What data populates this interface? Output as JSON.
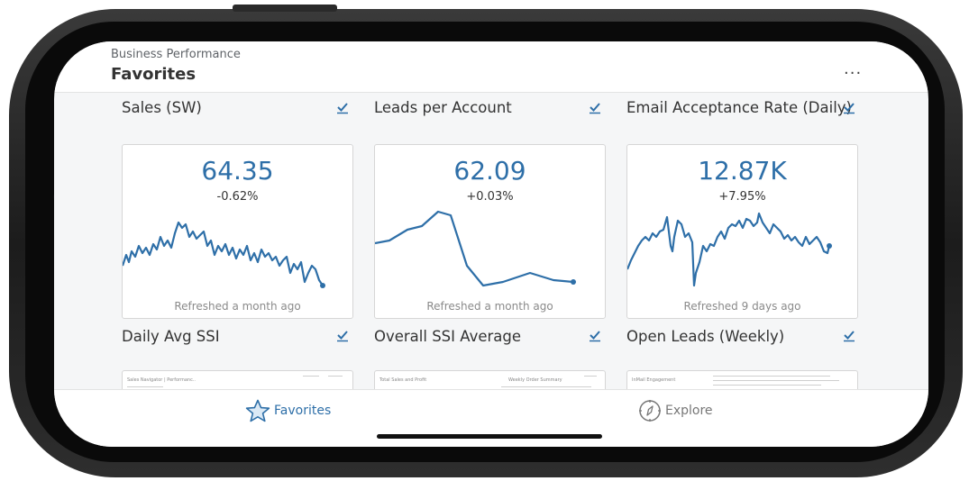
{
  "header": {
    "breadcrumb": "Business Performance",
    "title": "Favorites",
    "more_label": "..."
  },
  "cards": [
    {
      "title": "Sales (SW)",
      "value": "64.35",
      "change": "-0.62%",
      "refreshed": "Refreshed a month ago",
      "favorite_icon": "favorite-check-icon"
    },
    {
      "title": "Leads per Account",
      "value": "62.09",
      "change": "+0.03%",
      "refreshed": "Refreshed a month ago",
      "favorite_icon": "favorite-check-icon"
    },
    {
      "title": "Email Acceptance Rate (Daily)",
      "value": "12.87K",
      "change": "+7.95%",
      "refreshed": "Refreshed 9 days ago",
      "favorite_icon": "favorite-check-icon"
    },
    {
      "title": "Daily Avg SSI",
      "preview_text": "Sales Navigator | Performanc..",
      "favorite_icon": "favorite-check-icon"
    },
    {
      "title": "Overall SSI Average",
      "preview_text": "Total Sales and Profit",
      "preview_text_2": "Weekly Order Summary",
      "favorite_icon": "favorite-check-icon"
    },
    {
      "title": "Open Leads (Weekly)",
      "preview_text": "InMail Engagement",
      "favorite_icon": "favorite-check-icon"
    }
  ],
  "tabs": [
    {
      "label": "Favorites",
      "icon": "star-icon",
      "active": true
    },
    {
      "label": "Explore",
      "icon": "compass-icon",
      "active": false
    }
  ],
  "colors": {
    "accent": "#2e6fa8",
    "text": "#333333",
    "muted": "#8a8a8a",
    "inactive_tab": "#777777"
  }
}
